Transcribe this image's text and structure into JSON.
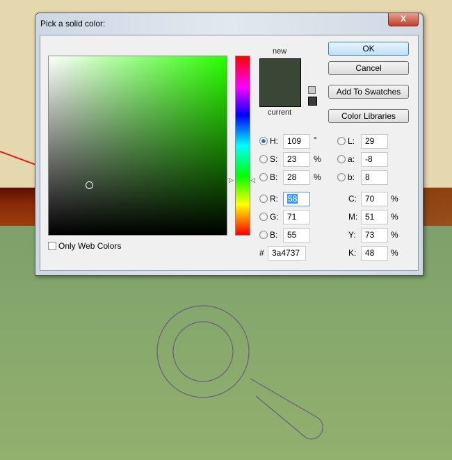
{
  "dialog": {
    "title": "Pick a solid color:",
    "close_label": "X"
  },
  "swatch": {
    "new_label": "new",
    "current_label": "current",
    "new_color": "#3a4737",
    "current_color": "#3a4737"
  },
  "buttons": {
    "ok": "OK",
    "cancel": "Cancel",
    "add_to_swatches": "Add To Swatches",
    "color_libraries": "Color Libraries"
  },
  "hsb": {
    "h_label": "H:",
    "h": "109",
    "h_unit": "°",
    "s_label": "S:",
    "s": "23",
    "s_unit": "%",
    "b_label": "B:",
    "b": "28",
    "b_unit": "%"
  },
  "lab": {
    "l_label": "L:",
    "l": "29",
    "a_label": "a:",
    "a": "-8",
    "b_label": "b:",
    "b": "8"
  },
  "rgb": {
    "r_label": "R:",
    "r": "58",
    "g_label": "G:",
    "g": "71",
    "b_label": "B:",
    "b": "55"
  },
  "cmyk": {
    "c_label": "C:",
    "c": "70",
    "m_label": "M:",
    "m": "51",
    "y_label": "Y:",
    "y": "73",
    "k_label": "K:",
    "k": "48",
    "unit": "%"
  },
  "hex": {
    "label": "#",
    "value": "3a4737"
  },
  "only_web_colors": "Only Web Colors"
}
